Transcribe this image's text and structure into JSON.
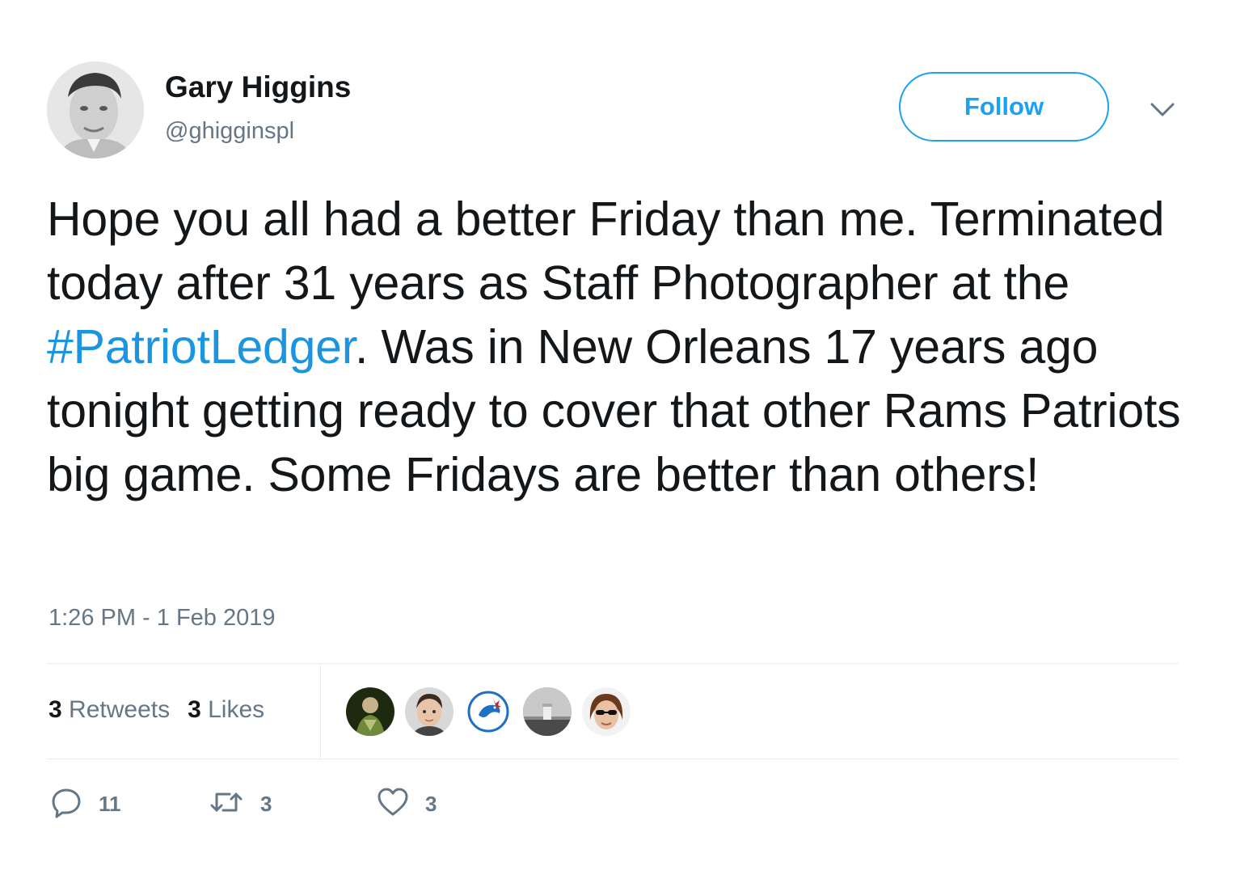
{
  "user": {
    "display_name": "Gary Higgins",
    "handle": "@ghigginspl"
  },
  "follow_button": {
    "label": "Follow"
  },
  "tweet": {
    "text_before": "Hope you all had a better Friday than me. Terminated today after 31 years as Staff Photographer at the ",
    "hashtag": "#PatriotLedger",
    "text_after": ". Was in New Orleans 17 years ago tonight getting ready to cover that other Rams Patriots big game. Some Fridays are better than others!",
    "timestamp": "1:26 PM - 1 Feb 2019"
  },
  "stats": {
    "retweets_count": "3",
    "retweets_label": "Retweets",
    "likes_count": "3",
    "likes_label": "Likes"
  },
  "actions": {
    "reply_count": "11",
    "retweet_count": "3",
    "like_count": "3"
  },
  "colors": {
    "accent": "#1da1f2",
    "hashtag": "#1b95e0",
    "secondary_text": "#657786",
    "primary_text": "#14171a",
    "divider": "#e6ecf0"
  },
  "icons": [
    "chevron-down-icon",
    "reply-icon",
    "retweet-icon",
    "heart-icon"
  ]
}
